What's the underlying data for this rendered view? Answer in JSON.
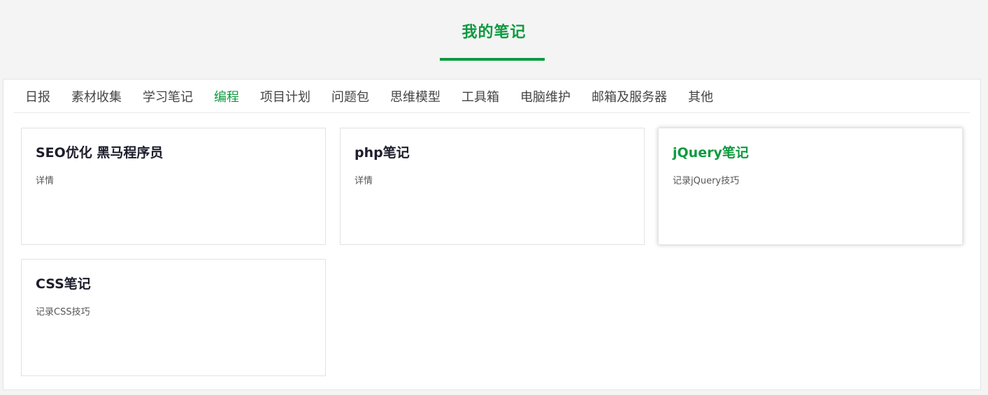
{
  "header": {
    "title": "我的笔记"
  },
  "tabs": [
    {
      "label": "日报"
    },
    {
      "label": "素材收集"
    },
    {
      "label": "学习笔记"
    },
    {
      "label": "编程",
      "active": true
    },
    {
      "label": "项目计划"
    },
    {
      "label": "问题包"
    },
    {
      "label": "思维模型"
    },
    {
      "label": "工具箱"
    },
    {
      "label": "电脑维护"
    },
    {
      "label": "邮箱及服务器"
    },
    {
      "label": "其他"
    }
  ],
  "cards": [
    {
      "title": "SEO优化 黑马程序员",
      "desc": "详情"
    },
    {
      "title": "php笔记",
      "desc": "详情"
    },
    {
      "title": "jQuery笔记",
      "desc": "记录jQuery技巧",
      "hover": true
    },
    {
      "title": "CSS笔记",
      "desc": "记录CSS技巧"
    }
  ],
  "colors": {
    "accent": "#0d9a3f",
    "background": "#f4f4f4"
  }
}
